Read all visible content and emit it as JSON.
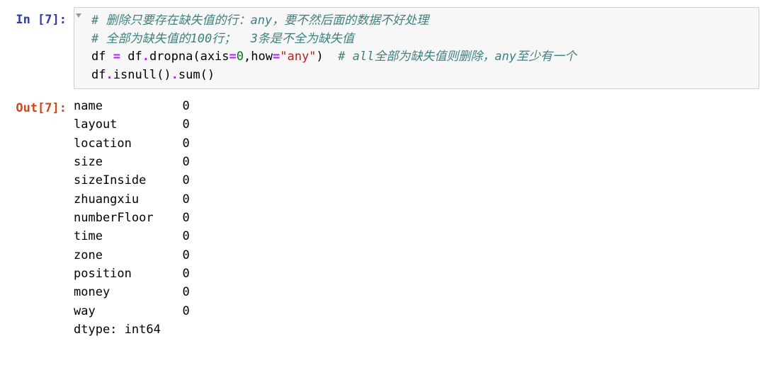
{
  "input": {
    "prompt": "In [7]:",
    "comment1": "# 删除只要存在缺失值的行：any，要不然后面的数据不好处理",
    "comment2": "# 全部为缺失值的100行；  3条是不全为缺失值",
    "line3": {
      "pre": "df ",
      "op1": "=",
      "mid1": " df",
      "dot1": ".",
      "func1": "dropna(axis",
      "op2": "=",
      "num1": "0",
      "mid2": ",how",
      "op3": "=",
      "str1": "\"any\"",
      "close1": ")  ",
      "comment3": "# all全部为缺失值则删除，any至少有一个"
    },
    "line4": {
      "part1": "df",
      "dot1": ".",
      "part2": "isnull()",
      "dot2": ".",
      "part3": "sum()"
    }
  },
  "output": {
    "prompt": "Out[7]:",
    "rows": [
      {
        "name": "name",
        "val": "0"
      },
      {
        "name": "layout",
        "val": "0"
      },
      {
        "name": "location",
        "val": "0"
      },
      {
        "name": "size",
        "val": "0"
      },
      {
        "name": "sizeInside",
        "val": "0"
      },
      {
        "name": "zhuangxiu",
        "val": "0"
      },
      {
        "name": "numberFloor",
        "val": "0"
      },
      {
        "name": "time",
        "val": "0"
      },
      {
        "name": "zone",
        "val": "0"
      },
      {
        "name": "position",
        "val": "0"
      },
      {
        "name": "money",
        "val": "0"
      },
      {
        "name": "way",
        "val": "0"
      }
    ],
    "dtype": "dtype: int64"
  }
}
